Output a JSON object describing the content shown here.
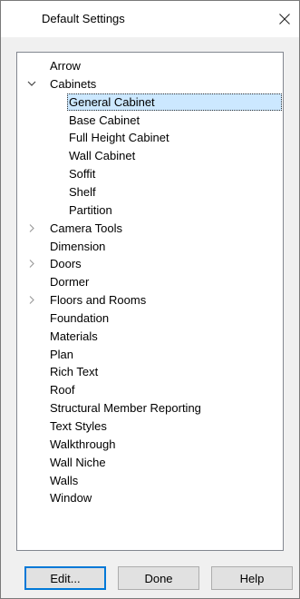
{
  "window": {
    "title": "Default Settings"
  },
  "tree": {
    "items": [
      {
        "label": "Arrow",
        "level": 0,
        "expander": ""
      },
      {
        "label": "Cabinets",
        "level": 0,
        "expander": "expanded"
      },
      {
        "label": "General Cabinet",
        "level": 1,
        "expander": "",
        "selected": true
      },
      {
        "label": "Base Cabinet",
        "level": 1,
        "expander": ""
      },
      {
        "label": "Full Height Cabinet",
        "level": 1,
        "expander": ""
      },
      {
        "label": "Wall Cabinet",
        "level": 1,
        "expander": ""
      },
      {
        "label": "Soffit",
        "level": 1,
        "expander": ""
      },
      {
        "label": "Shelf",
        "level": 1,
        "expander": ""
      },
      {
        "label": "Partition",
        "level": 1,
        "expander": ""
      },
      {
        "label": "Camera Tools",
        "level": 0,
        "expander": "collapsed"
      },
      {
        "label": "Dimension",
        "level": 0,
        "expander": ""
      },
      {
        "label": "Doors",
        "level": 0,
        "expander": "collapsed"
      },
      {
        "label": "Dormer",
        "level": 0,
        "expander": ""
      },
      {
        "label": "Floors and Rooms",
        "level": 0,
        "expander": "collapsed"
      },
      {
        "label": "Foundation",
        "level": 0,
        "expander": ""
      },
      {
        "label": "Materials",
        "level": 0,
        "expander": ""
      },
      {
        "label": "Plan",
        "level": 0,
        "expander": ""
      },
      {
        "label": "Rich Text",
        "level": 0,
        "expander": ""
      },
      {
        "label": "Roof",
        "level": 0,
        "expander": ""
      },
      {
        "label": "Structural Member Reporting",
        "level": 0,
        "expander": ""
      },
      {
        "label": "Text Styles",
        "level": 0,
        "expander": ""
      },
      {
        "label": "Walkthrough",
        "level": 0,
        "expander": ""
      },
      {
        "label": "Wall Niche",
        "level": 0,
        "expander": ""
      },
      {
        "label": "Walls",
        "level": 0,
        "expander": ""
      },
      {
        "label": "Window",
        "level": 0,
        "expander": ""
      }
    ]
  },
  "buttons": {
    "edit": "Edit...",
    "done": "Done",
    "help": "Help"
  },
  "icons": {
    "close": "close-icon",
    "expanded": "chevron-down-icon",
    "collapsed": "chevron-right-icon"
  },
  "colors": {
    "selection": "#cce8ff",
    "default_button_border": "#0078d7"
  }
}
